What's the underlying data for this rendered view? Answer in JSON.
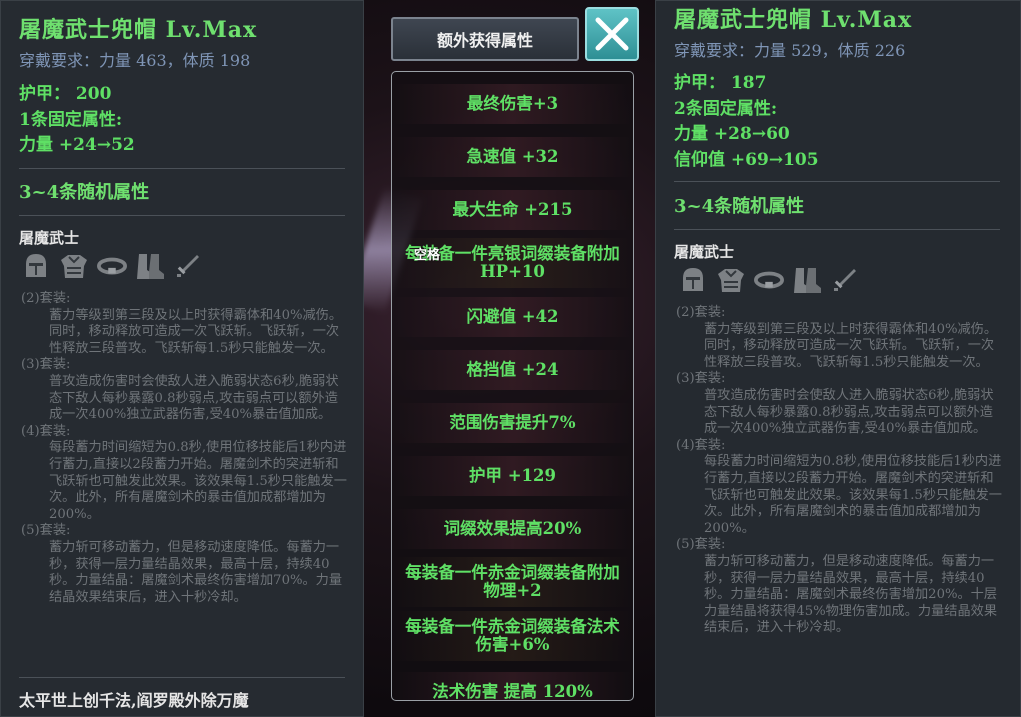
{
  "left_card": {
    "title": "屠魔武士兜帽 Lv.Max",
    "requirement": "穿戴要求：力量 463，体质 198",
    "armor": "护甲： 200",
    "fixed_header": "1条固定属性:",
    "fixed_attrs": [
      "力量 +24→52"
    ],
    "random_header": "3~4条随机属性",
    "set_name": "屠魔武士",
    "set_icons": [
      "helmet-icon",
      "armor-icon",
      "belt-icon",
      "boots-icon",
      "sword-icon"
    ],
    "set_bonuses": [
      {
        "label": "(2)套装:",
        "text": "蓄力等级到第三段及以上时获得霸体和40%减伤。同时，移动释放可造成一次飞跃斩。飞跃斩，一次性释放三段普攻。飞跃斩每1.5秒只能触发一次。"
      },
      {
        "label": "(3)套装:",
        "text": "普攻造成伤害时会使敌人进入脆弱状态6秒,脆弱状态下敌人每秒暴露0.8秒弱点,攻击弱点可以额外造成一次400%独立武器伤害,受40%暴击值加成。"
      },
      {
        "label": "(4)套装:",
        "text": "每段蓄力时间缩短为0.8秒,使用位移技能后1秒内进行蓄力,直接以2段蓄力开始。屠魔剑术的突进斩和飞跃斩也可触发此效果。该效果每1.5秒只能触发一次。此外，所有屠魔剑术的暴击值加成都增加为200%。"
      },
      {
        "label": "(5)套装:",
        "text": "蓄力斩可移动蓄力，但是移动速度降低。每蓄力一秒，获得一层力量结晶效果，最高十层，持续40秒。力量结晶：屠魔剑术最终伤害增加70%。力量结晶效果结束后，进入十秒冷却。"
      }
    ],
    "motto": "太平世上创千法,阎罗殿外除万魔"
  },
  "right_card": {
    "title": "屠魔武士兜帽 Lv.Max",
    "requirement": "穿戴要求：力量 529，体质 226",
    "armor": "护甲： 187",
    "fixed_header": "2条固定属性:",
    "fixed_attrs": [
      "力量 +28→60",
      "信仰值 +69→105"
    ],
    "random_header": "3~4条随机属性",
    "set_name": "屠魔武士",
    "set_icons": [
      "helmet-icon",
      "armor-icon",
      "belt-icon",
      "boots-icon",
      "sword-icon"
    ],
    "set_bonuses": [
      {
        "label": "(2)套装:",
        "text": "蓄力等级到第三段及以上时获得霸体和40%减伤。同时，移动释放可造成一次飞跃斩。飞跃斩，一次性释放三段普攻。飞跃斩每1.5秒只能触发一次。"
      },
      {
        "label": "(3)套装:",
        "text": "普攻造成伤害时会使敌人进入脆弱状态6秒,脆弱状态下敌人每秒暴露0.8秒弱点,攻击弱点可以额外造成一次400%独立武器伤害,受40%暴击值加成。"
      },
      {
        "label": "(4)套装:",
        "text": "每段蓄力时间缩短为0.8秒,使用位移技能后1秒内进行蓄力,直接以2段蓄力开始。屠魔剑术的突进斩和飞跃斩也可触发此效果。该效果每1.5秒只能触发一次。此外，所有屠魔剑术的暴击值加成都增加为200%。"
      },
      {
        "label": "(5)套装:",
        "text": "蓄力斩可移动蓄力，但是移动速度降低。每蓄力一秒，获得一层力量结晶效果，最高十层，持续40秒。力量结晶：屠魔剑术最终伤害增加20%。十层力量结晶将获得45%物理伤害加成。力量结晶效果结束后，进入十秒冷却。"
      }
    ]
  },
  "center": {
    "tab_label": "额外获得属性",
    "close_icon": "close-icon",
    "hotkey_label": "空格",
    "attributes": [
      "最终伤害+3",
      "急速值 +32",
      "最大生命 +215",
      "每装备一件亮银词缀装备附加HP+10",
      "闪避值 +42",
      "格挡值 +24",
      "范围伤害提升7%",
      "护甲 +129",
      "词缀效果提高20%",
      "每装备一件赤金词缀装备附加物理+2",
      "每装备一件赤金词缀装备法术伤害+6%",
      "法术伤害 提高 120%"
    ]
  },
  "colors": {
    "green_text": "#5fe065",
    "title_green": "#6fe06f",
    "requirement_blue": "#7f95b6",
    "panel_bg": "#262b31",
    "close_teal": "#3aa7ac"
  }
}
